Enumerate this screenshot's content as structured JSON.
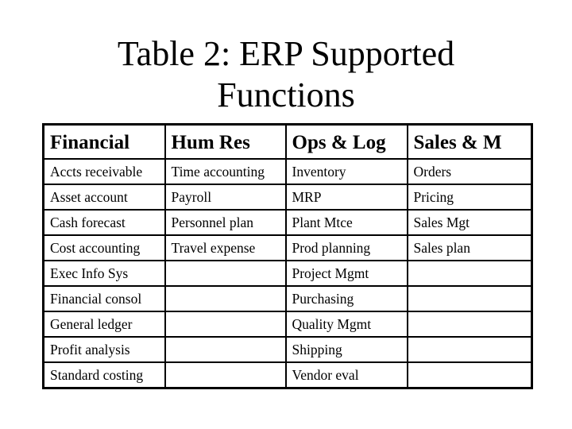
{
  "slide": {
    "title_line1": "Table 2: ERP Supported",
    "title_line2": "Functions"
  },
  "table": {
    "headers": [
      "Financial",
      "Hum Res",
      "Ops & Log",
      "Sales & M"
    ],
    "rows": [
      [
        "Accts receivable",
        "Time accounting",
        "Inventory",
        "Orders"
      ],
      [
        "Asset account",
        "Payroll",
        "MRP",
        "Pricing"
      ],
      [
        "Cash forecast",
        "Personnel plan",
        "Plant Mtce",
        "Sales Mgt"
      ],
      [
        "Cost accounting",
        "Travel expense",
        "Prod planning",
        "Sales plan"
      ],
      [
        "Exec Info Sys",
        "",
        "Project Mgmt",
        ""
      ],
      [
        "Financial consol",
        "",
        "Purchasing",
        ""
      ],
      [
        "General ledger",
        "",
        "Quality Mgmt",
        ""
      ],
      [
        "Profit analysis",
        "",
        "Shipping",
        ""
      ],
      [
        "Standard costing",
        "",
        "Vendor eval",
        ""
      ]
    ]
  }
}
